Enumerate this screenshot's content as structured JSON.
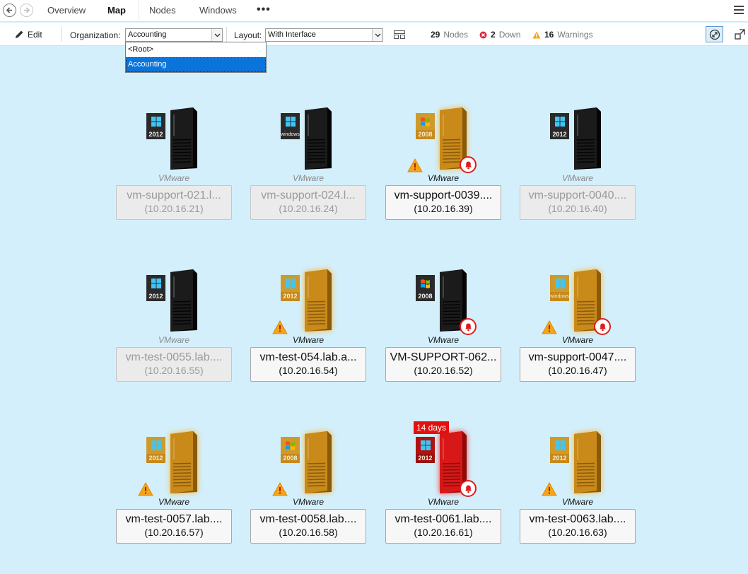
{
  "nav": {
    "tabs": [
      {
        "label": "Overview",
        "active": false
      },
      {
        "label": "Map",
        "active": true
      },
      {
        "label": "Nodes",
        "active": false
      },
      {
        "label": "Windows",
        "active": false
      }
    ],
    "more_label": "•••"
  },
  "toolbar": {
    "edit_label": "Edit",
    "organization_label": "Organization:",
    "organization_value": "Accounting",
    "layout_label": "Layout:",
    "layout_value": "With Interface",
    "nodes_count": "29",
    "nodes_label": "Nodes",
    "down_count": "2",
    "down_label": "Down",
    "warnings_count": "16",
    "warnings_label": "Warnings"
  },
  "org_dropdown": {
    "options": [
      "<Root>",
      "Accounting"
    ],
    "selected": "Accounting"
  },
  "colors": {
    "background": "#d3effb",
    "server_dark": "#1b1b1b",
    "server_warning": "#c98a1a",
    "server_critical": "#d81818",
    "alert_red": "#e21b1b",
    "warning_yellow": "#f3a41a",
    "selected_blue": "#0a74db"
  },
  "nodes": [
    {
      "name": "vm-support-021.l...",
      "ip": "(10.20.16.21)",
      "vendor": "VMware",
      "os": "2012",
      "os_logo": "windows-2012-icon",
      "state": "off",
      "server": "dark",
      "warning": false,
      "alarm": false,
      "badge": ""
    },
    {
      "name": "vm-support-024.l...",
      "ip": "(10.20.16.24)",
      "vendor": "VMware",
      "os": "windows",
      "os_logo": "windows-generic-icon",
      "state": "off",
      "server": "dark",
      "warning": false,
      "alarm": false,
      "badge": ""
    },
    {
      "name": "vm-support-0039....",
      "ip": "(10.20.16.39)",
      "vendor": "VMware",
      "os": "2008",
      "os_logo": "windows-2008-icon",
      "state": "on",
      "server": "warning",
      "warning": true,
      "alarm": true,
      "badge": ""
    },
    {
      "name": "vm-support-0040....",
      "ip": "(10.20.16.40)",
      "vendor": "VMware",
      "os": "2012",
      "os_logo": "windows-2012-icon",
      "state": "off",
      "server": "dark",
      "warning": false,
      "alarm": false,
      "badge": ""
    },
    {
      "name": "vm-test-0055.lab....",
      "ip": "(10.20.16.55)",
      "vendor": "VMware",
      "os": "2012",
      "os_logo": "windows-2012-icon",
      "state": "off",
      "server": "dark",
      "warning": false,
      "alarm": false,
      "badge": ""
    },
    {
      "name": "vm-test-054.lab.a...",
      "ip": "(10.20.16.54)",
      "vendor": "VMware",
      "os": "2012",
      "os_logo": "windows-2012-icon",
      "state": "on",
      "server": "warning",
      "warning": true,
      "alarm": false,
      "badge": ""
    },
    {
      "name": "VM-SUPPORT-062...",
      "ip": "(10.20.16.52)",
      "vendor": "VMware",
      "os": "2008",
      "os_logo": "windows-2008-icon",
      "state": "on",
      "server": "dark",
      "warning": false,
      "alarm": true,
      "badge": ""
    },
    {
      "name": "vm-support-0047....",
      "ip": "(10.20.16.47)",
      "vendor": "VMware",
      "os": "windows",
      "os_logo": "windows-generic-icon",
      "state": "on",
      "server": "warning",
      "warning": true,
      "alarm": true,
      "badge": ""
    },
    {
      "name": "vm-test-0057.lab....",
      "ip": "(10.20.16.57)",
      "vendor": "VMware",
      "os": "2012",
      "os_logo": "windows-2012-icon",
      "state": "on",
      "server": "warning",
      "warning": true,
      "alarm": false,
      "badge": ""
    },
    {
      "name": "vm-test-0058.lab....",
      "ip": "(10.20.16.58)",
      "vendor": "VMware",
      "os": "2008",
      "os_logo": "windows-2008-icon",
      "state": "on",
      "server": "warning",
      "warning": true,
      "alarm": false,
      "badge": ""
    },
    {
      "name": "vm-test-0061.lab....",
      "ip": "(10.20.16.61)",
      "vendor": "VMware",
      "os": "2012",
      "os_logo": "windows-2012-icon",
      "state": "on",
      "server": "critical",
      "warning": false,
      "alarm": true,
      "badge": "14 days"
    },
    {
      "name": "vm-test-0063.lab....",
      "ip": "(10.20.16.63)",
      "vendor": "VMware",
      "os": "2012",
      "os_logo": "windows-2012-icon",
      "state": "on",
      "server": "warning",
      "warning": true,
      "alarm": false,
      "badge": ""
    }
  ]
}
